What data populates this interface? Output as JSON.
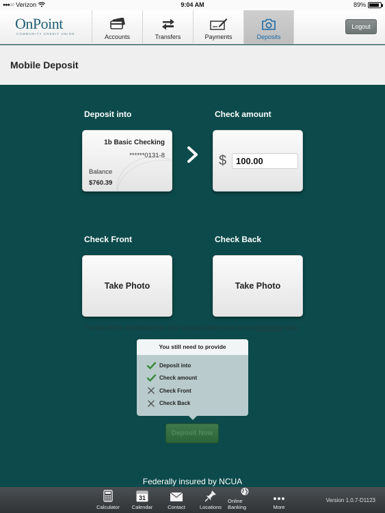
{
  "status_bar": {
    "carrier": "Verizon",
    "time": "9:04 AM",
    "battery": "89%",
    "battery_level": 0.89
  },
  "header": {
    "logo_text": "OnPoint",
    "logo_sub": "COMMUNITY CREDIT UNION",
    "tabs": [
      {
        "label": "Accounts",
        "icon": "cards-icon",
        "active": false
      },
      {
        "label": "Transfers",
        "icon": "transfer-arrows-icon",
        "active": false
      },
      {
        "label": "Payments",
        "icon": "check-pen-icon",
        "active": false
      },
      {
        "label": "Deposits",
        "icon": "camera-icon",
        "active": true
      }
    ],
    "logout_label": "Logout"
  },
  "page": {
    "title": "Mobile Deposit"
  },
  "deposit": {
    "deposit_into_label": "Deposit into",
    "check_amount_label": "Check amount",
    "account_name": "1b Basic Checking",
    "account_number": "******0131-8",
    "balance_label": "Balance",
    "balance_value": "$760.39",
    "currency_symbol": "$",
    "amount_value": "100.00",
    "check_front_label": "Check Front",
    "check_back_label": "Check Back",
    "take_photo_label": "Take Photo",
    "note_prefix": "Funds will be deposited into your account within one to two",
    "note_link": "business",
    "note_suffix": "days.",
    "deposit_button_label": "Deposit Now"
  },
  "requirements": {
    "title": "You still need to provide",
    "items": [
      {
        "label": "Deposit into",
        "status": "done"
      },
      {
        "label": "Check amount",
        "status": "done"
      },
      {
        "label": "Check Front",
        "status": "missing"
      },
      {
        "label": "Check Back",
        "status": "missing"
      }
    ],
    "done_color": "#3a8a3a",
    "missing_color": "#555555"
  },
  "footer": {
    "ncua_text": "Federally insured by NCUA",
    "items": [
      {
        "label": "Calculator",
        "icon": "calculator-icon"
      },
      {
        "label": "Calendar",
        "icon": "calendar-icon",
        "badge": "31"
      },
      {
        "label": "Contact",
        "icon": "envelope-icon"
      },
      {
        "label": "Locations",
        "icon": "pin-icon"
      },
      {
        "label": "Online Banking",
        "icon": "globe-icon"
      },
      {
        "label": "More",
        "icon": "dots-icon"
      }
    ],
    "version": "Version 1.0.7-D1123"
  },
  "colors": {
    "background": "#0c4a4b",
    "active_tab_text": "#1a6aa8"
  }
}
